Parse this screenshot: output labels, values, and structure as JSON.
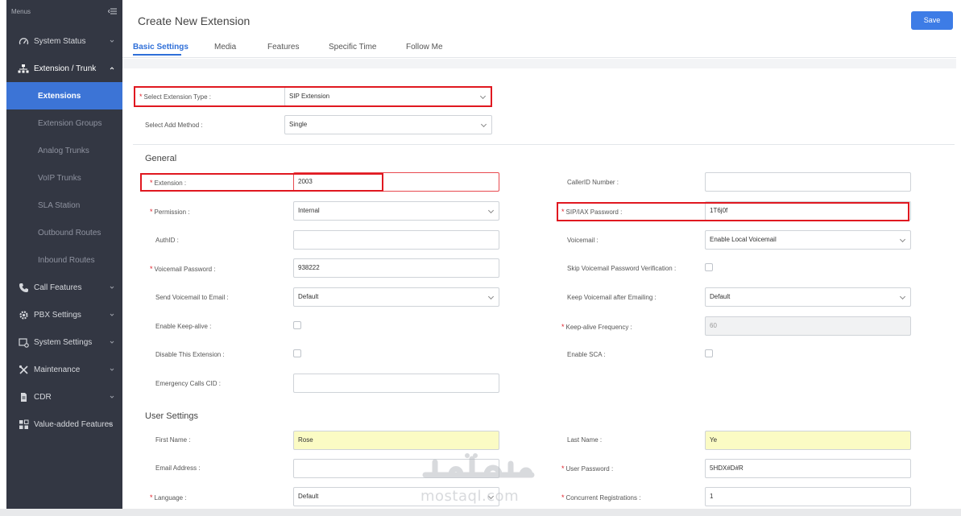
{
  "sidebar": {
    "title": "Menus",
    "items": [
      {
        "label": "System Status",
        "icon": "gauge-icon"
      },
      {
        "label": "Extension / Trunk",
        "icon": "network-icon"
      },
      {
        "label": "Call Features",
        "icon": "phone-icon"
      },
      {
        "label": "PBX Settings",
        "icon": "gear-icon"
      },
      {
        "label": "System Settings",
        "icon": "settings-screen-icon"
      },
      {
        "label": "Maintenance",
        "icon": "wrench-icon"
      },
      {
        "label": "CDR",
        "icon": "document-icon"
      },
      {
        "label": "Value-added Features",
        "icon": "grid-icon"
      }
    ],
    "subitems": [
      {
        "label": "Extensions",
        "active": true
      },
      {
        "label": "Extension Groups"
      },
      {
        "label": "Analog Trunks"
      },
      {
        "label": "VoIP Trunks"
      },
      {
        "label": "SLA Station"
      },
      {
        "label": "Outbound Routes"
      },
      {
        "label": "Inbound Routes"
      }
    ]
  },
  "header": {
    "title": "Create New Extension",
    "save_label": "Save",
    "accent": "#3d7ce6"
  },
  "tabs": [
    "Basic Settings",
    "Media",
    "Features",
    "Specific Time",
    "Follow Me"
  ],
  "form": {
    "ext_type_label": "Select Extension Type :",
    "ext_type_value": "SIP Extension",
    "add_method_label": "Select Add Method :",
    "add_method_value": "Single",
    "general_title": "General",
    "extension_label": "Extension :",
    "extension_value": "2003",
    "callerid_label": "CallerID Number :",
    "callerid_value": "",
    "permission_label": "Permission :",
    "permission_value": "Internal",
    "sip_password_label": "SIP/IAX Password :",
    "sip_password_value": "1T6j0f",
    "authid_label": "AuthID :",
    "authid_value": "",
    "voicemail_label": "Voicemail :",
    "voicemail_value": "Enable Local Voicemail",
    "vm_password_label": "Voicemail Password :",
    "vm_password_value": "938222",
    "skip_vm_label": "Skip Voicemail Password Verification :",
    "send_vm_label": "Send Voicemail to Email :",
    "send_vm_value": "Default",
    "keep_vm_label": "Keep Voicemail after Emailing :",
    "keep_vm_value": "Default",
    "keepalive_label": "Enable Keep-alive :",
    "keepalive_freq_label": "Keep-alive Frequency :",
    "keepalive_freq_value": "60",
    "disable_label": "Disable This Extension :",
    "sca_label": "Enable SCA :",
    "emergency_label": "Emergency Calls CID :",
    "emergency_value": "",
    "user_title": "User Settings",
    "first_name_label": "First Name :",
    "first_name_value": "Rose",
    "last_name_label": "Last Name :",
    "last_name_value": "Ye",
    "email_label": "Email Address :",
    "email_value": "",
    "user_password_label": "User Password :",
    "user_password_value": "5HDX#D#R",
    "language_label": "Language :",
    "language_value": "Default",
    "concurrent_label": "Concurrent Registrations :",
    "concurrent_value": "1"
  },
  "watermark": {
    "text": "mostaql.com"
  },
  "colors": {
    "highlight": "#e01820",
    "sidebar_bg": "#333743",
    "active_bg": "#3c74d6",
    "required": "#e0202a"
  }
}
